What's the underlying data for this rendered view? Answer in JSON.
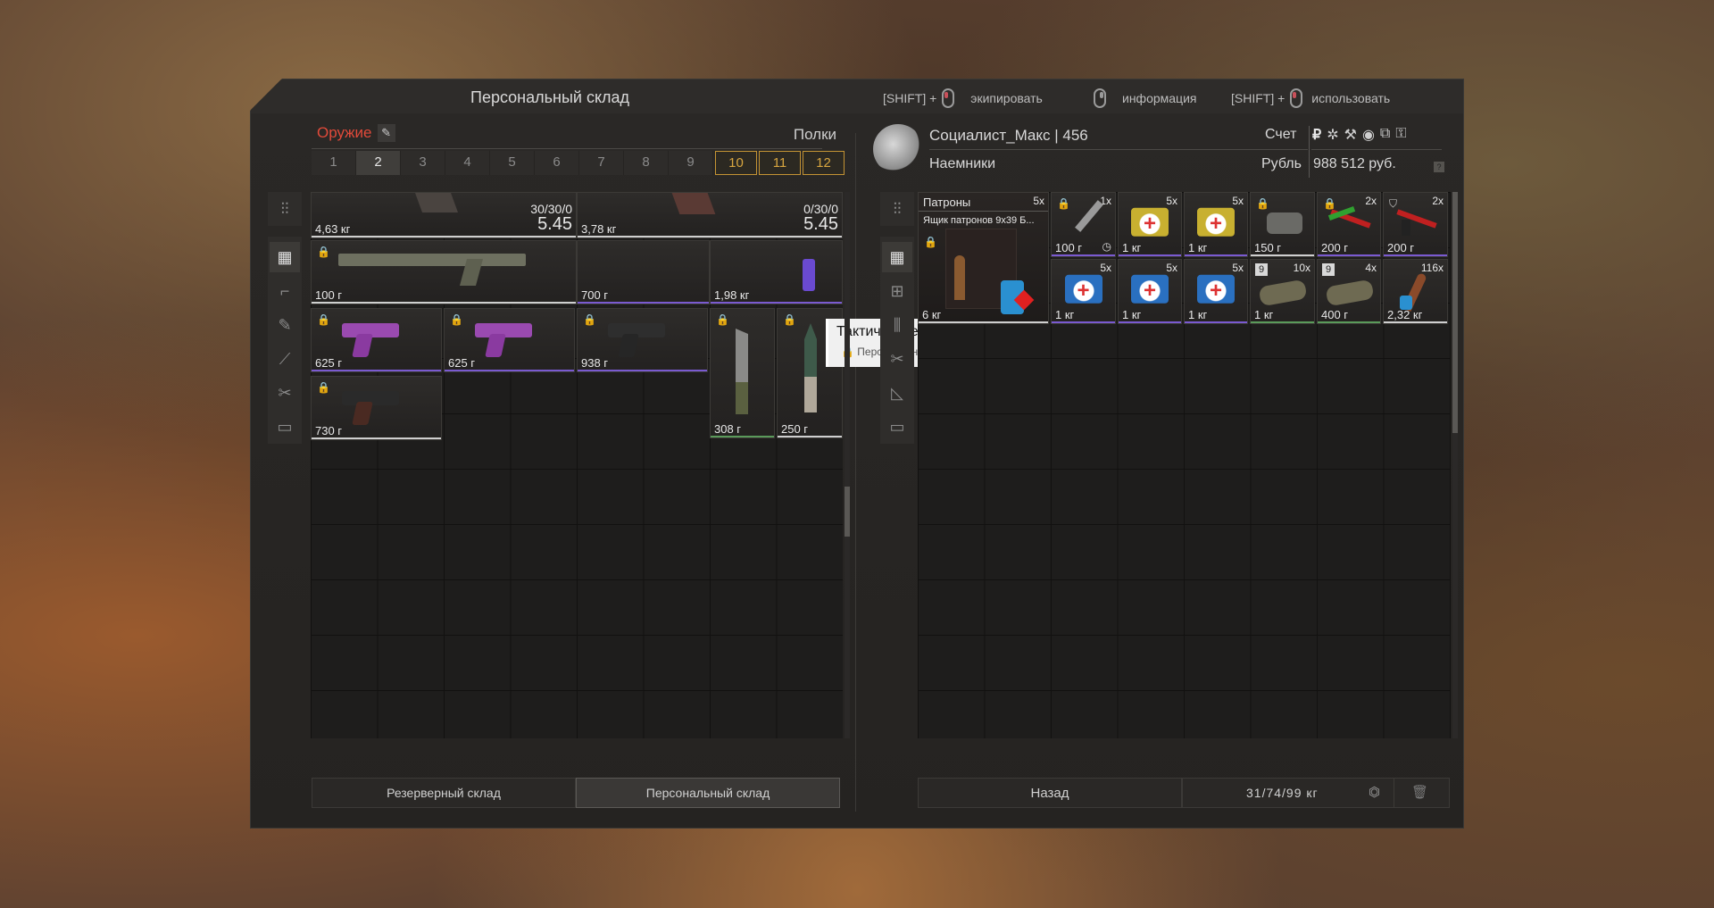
{
  "left_panel": {
    "title": "Персональный склад",
    "category": "Оружие",
    "shelves_label": "Полки",
    "tabs": [
      "1",
      "2",
      "3",
      "4",
      "5",
      "6",
      "7",
      "8",
      "9",
      "10",
      "11",
      "12"
    ],
    "selected_tab": "2",
    "items": [
      {
        "weight": "4,63 кг",
        "ammo": "30/30/0",
        "caliber": "5.45"
      },
      {
        "weight": "3,78 кг",
        "ammo": "0/30/0",
        "caliber": "5.45"
      },
      {
        "weight": "100 г"
      },
      {
        "weight": "700 г"
      },
      {
        "weight": "1,98 кг"
      },
      {
        "weight": "625 г"
      },
      {
        "weight": "625 г"
      },
      {
        "weight": "938 г"
      },
      {
        "weight": "308 г"
      },
      {
        "weight": "250 г"
      },
      {
        "weight": "730 г"
      }
    ],
    "tooltip": {
      "title": "Тактическое ложе для СКС",
      "subtitle": "Персональный предмет"
    },
    "bottom_buttons": {
      "reserve": "Резерверный склад",
      "personal": "Персональный склад"
    }
  },
  "hints": {
    "equip_prefix": "[SHIFT] +",
    "equip": "экипировать",
    "info": "информация",
    "use_prefix": "[SHIFT] +",
    "use": "использовать"
  },
  "right_panel": {
    "player": "Социалист_Макс | 456",
    "faction": "Наемники",
    "account_label": "Счет",
    "currency_label": "Рубль",
    "balance": "988 512 руб.",
    "currency_icons": [
      "ruble-icon",
      "gear-icon",
      "wrench-icon",
      "badge-icon",
      "tape-icon",
      "tag-icon"
    ],
    "items": [
      {
        "count": "5x",
        "weight": "6 кг",
        "title": "Патроны",
        "subtitle": "Ящик патронов 9x39 Б..."
      },
      {
        "count": "1x",
        "weight": "100 г"
      },
      {
        "count": "5x",
        "weight": "1 кг"
      },
      {
        "count": "5x",
        "weight": "1 кг"
      },
      {
        "weight": "150 г"
      },
      {
        "count": "2x",
        "weight": "200 г"
      },
      {
        "count": "2x",
        "weight": "200 г"
      },
      {
        "count": "5x",
        "weight": "1 кг"
      },
      {
        "count": "5x",
        "weight": "1 кг"
      },
      {
        "count": "5x",
        "weight": "1 кг"
      },
      {
        "count": "10x",
        "weight": "1 кг",
        "badge": "9"
      },
      {
        "count": "4x",
        "weight": "400 г",
        "badge": "9"
      },
      {
        "count": "116x",
        "weight": "2,32 кг"
      }
    ],
    "back_button": "Назад",
    "capacity": "31/74/99 кг"
  },
  "colors": {
    "accent_red": "#e24a3a",
    "gold": "#d8a640",
    "rare_purple": "#7a5ad0",
    "common_green": "#5a9a5a",
    "white_rarity": "#cfcfcf"
  }
}
